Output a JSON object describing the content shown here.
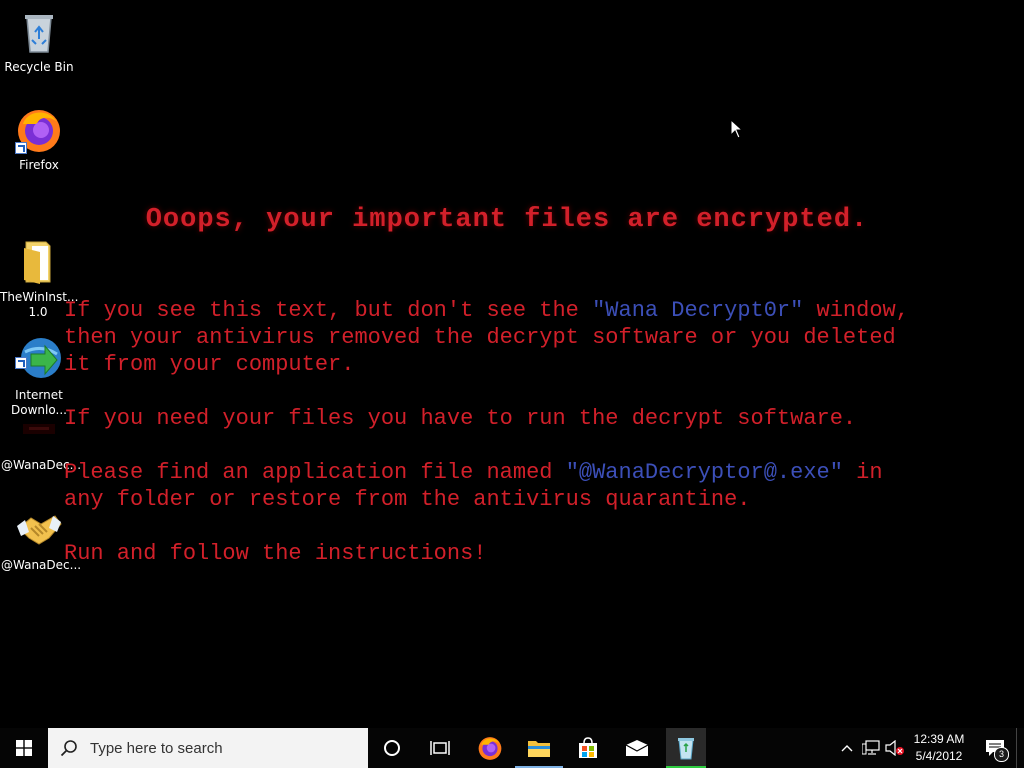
{
  "desktop_icons": [
    {
      "label": "Recycle Bin",
      "icon": "recycle-bin-icon"
    },
    {
      "label": "Firefox",
      "icon": "firefox-icon"
    },
    {
      "label": "TheWinInst...\n1.0",
      "icon": "folder-icon"
    },
    {
      "label": "Internet\nDownlo...",
      "icon": "internet-download-manager-icon"
    },
    {
      "label": "@WanaDec...",
      "icon": "wanadecryptor-icon"
    },
    {
      "label": "@WanaDec...",
      "icon": "handshake-icon"
    }
  ],
  "ransom_note": {
    "title": "Ooops, your important files are encrypted.",
    "p1_a": "If you see this text, but don't see the ",
    "p1_highlight": "\"Wana Decrypt0r\"",
    "p1_b": " window,\nthen your antivirus removed the decrypt software or you deleted\nit from your computer.",
    "p2": "If you need your files you have to run the decrypt software.",
    "p3_a": "Please find an application file named ",
    "p3_highlight": "\"@WanaDecryptor@.exe\"",
    "p3_b": " in\nany folder or restore from the antivirus quarantine.",
    "p4": "Run and follow the instructions!"
  },
  "taskbar": {
    "search_placeholder": "Type here to search",
    "pinned": [
      "cortana-icon",
      "task-view-icon",
      "firefox-icon",
      "file-explorer-icon",
      "microsoft-store-icon",
      "mail-icon",
      "recycle-app-icon"
    ],
    "clock_time": "12:39 AM",
    "clock_date": "5/4/2012",
    "notification_count": "3"
  },
  "colors": {
    "ransom_text": "#d2202a",
    "ransom_highlight": "#3c4fb8",
    "desktop_bg": "#000000",
    "taskbar_bg": "#050505"
  }
}
